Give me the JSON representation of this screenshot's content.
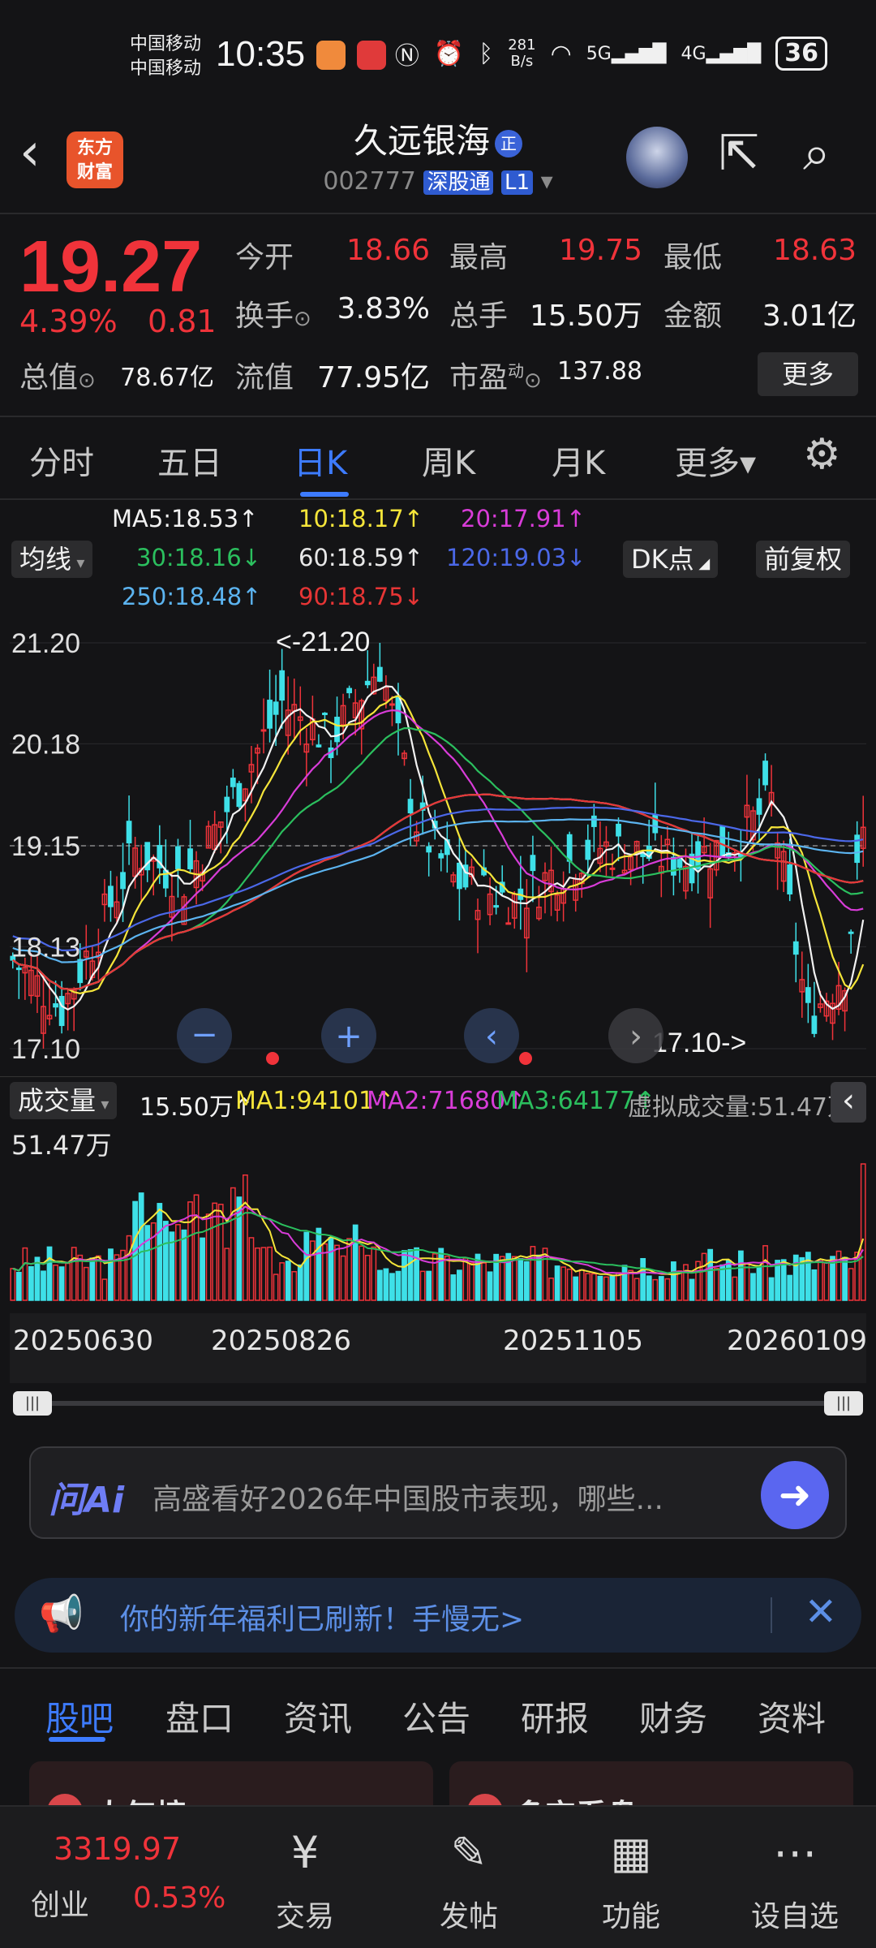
{
  "status_bar": {
    "carrier1": "中国移动",
    "carrier2": "中国移动",
    "time": "10:35",
    "net_speed_top": "281",
    "net_speed_bottom": "B/s",
    "signal1": "5G",
    "signal2": "4G",
    "battery": "36"
  },
  "header": {
    "back_label": "‹",
    "logo_line1": "东方",
    "logo_line2": "财富",
    "title": "久远银海",
    "title_badge": "正",
    "code": "002777",
    "market_tag": "深股通",
    "level_tag": "L1"
  },
  "quote": {
    "price": "19.27",
    "change_pct": "4.39%",
    "change_amt": "0.81",
    "open_label": "今开",
    "open_value": "18.66",
    "high_label": "最高",
    "high_value": "19.75",
    "low_label": "最低",
    "low_value": "18.63",
    "turnover_label": "换手",
    "turnover_value": "3.83%",
    "volume_label": "总手",
    "volume_value": "15.50万",
    "amount_label": "金额",
    "amount_value": "3.01亿",
    "mktcap_label": "总值",
    "mktcap_value": "78.67亿",
    "float_label": "流值",
    "float_value": "77.95亿",
    "pe_label": "市盈",
    "pe_sup": "动",
    "pe_value": "137.88",
    "more_label": "更多"
  },
  "kline_tabs": [
    {
      "label": "分时"
    },
    {
      "label": "五日"
    },
    {
      "label": "日K"
    },
    {
      "label": "周K"
    },
    {
      "label": "月K"
    },
    {
      "label": "更多▾"
    }
  ],
  "ma_indicators": {
    "avg_line_label": "均线",
    "ma5": "MA5:18.53↑",
    "ma10": "10:18.17↑",
    "ma20": "20:17.91↑",
    "ma30": "30:18.16↓",
    "ma60": "60:18.59↑",
    "ma120": "120:19.03↓",
    "ma250": "250:18.48↑",
    "ma90": "90:18.75↓",
    "dk_label": "DK点",
    "adjust_label": "前复权"
  },
  "chart_data": {
    "type": "candlestick",
    "ylim": [
      17.1,
      21.2
    ],
    "y_ticks": [
      "21.20",
      "20.18",
      "19.15",
      "18.13",
      "17.10"
    ],
    "max_label": "<-21.20",
    "min_label": "17.10->",
    "x_ticks": [
      "20250630",
      "20250826",
      "20251105",
      "20260109"
    ],
    "current_price_line": 19.15,
    "volume": {
      "label": "成交量",
      "value": "15.50万↑",
      "ma1": "MA1:94101↑",
      "ma2": "MA2:71680↑",
      "ma3": "MA3:64177↑",
      "virtual": "虚拟成交量:51.47万",
      "y_max_label": "51.47万"
    }
  },
  "ai": {
    "logo": "问Ai",
    "prompt": "高盛看好2026年中国股市表现，哪些..."
  },
  "banner": {
    "text": "你的新年福利已刷新！手慢无>"
  },
  "bottom_tabs": [
    {
      "label": "股吧"
    },
    {
      "label": "盘口"
    },
    {
      "label": "资讯"
    },
    {
      "label": "公告"
    },
    {
      "label": "研报"
    },
    {
      "label": "财务"
    },
    {
      "label": "资料"
    }
  ],
  "cards": {
    "left": "人气榜",
    "right": "多空看盘"
  },
  "nav": {
    "index_value": "3319.97",
    "index_name": "创业",
    "index_change": "0.53%",
    "items": [
      {
        "label": "交易",
        "icon": "yen-circle-icon"
      },
      {
        "label": "发帖",
        "icon": "edit-icon"
      },
      {
        "label": "功能",
        "icon": "grid-icon"
      },
      {
        "label": "设自选",
        "icon": "more-circle-icon"
      }
    ]
  }
}
